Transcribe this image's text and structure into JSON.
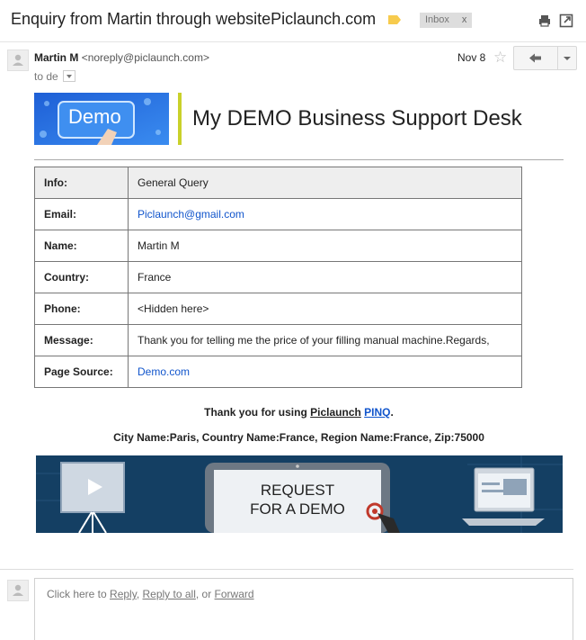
{
  "header": {
    "subject": "Enquiry from Martin through websitePiclaunch.com",
    "inbox_label": "Inbox",
    "inbox_close": "x",
    "icons": [
      "label-tag-icon",
      "print-icon",
      "new-window-icon"
    ]
  },
  "message": {
    "sender_name": "Martin M",
    "sender_email": "<noreply@piclaunch.com>",
    "to_line": "to de",
    "date": "Nov 8",
    "star": "☆",
    "icons": [
      "avatar-icon",
      "star-icon",
      "reply-icon",
      "more-options-icon"
    ]
  },
  "body": {
    "banner_text": "Demo",
    "desk_title": "My DEMO Business Support Desk",
    "accent_color": "#c9d12a",
    "table": [
      {
        "label": "Info:",
        "value": "General Query"
      },
      {
        "label": "Email:",
        "value": "Piclaunch@gmail.com"
      },
      {
        "label": "Name:",
        "value": "Martin M"
      },
      {
        "label": "Country:",
        "value": "France"
      },
      {
        "label": "Phone:",
        "value": "<Hidden here>"
      },
      {
        "label": "Message:",
        "value": "Thank you for telling me the price of your filling manual machine.Regards,"
      },
      {
        "label": "Page Source:",
        "value": "Demo.com"
      }
    ],
    "thanks_prefix": "Thank you for using ",
    "thanks_link": "Piclaunch",
    "thanks_pinq": "PINQ",
    "thanks_suffix": ".",
    "city_line": "City Name:Paris, Country Name:France, Region Name:France, Zip:75000",
    "demo_banner_line1": "REQUEST",
    "demo_banner_line2": "FOR A DEMO"
  },
  "reply": {
    "prefix": "Click here to ",
    "reply": "Reply",
    "sep1": ", ",
    "reply_all": "Reply to all",
    "sep2": ", or ",
    "forward": "Forward"
  }
}
